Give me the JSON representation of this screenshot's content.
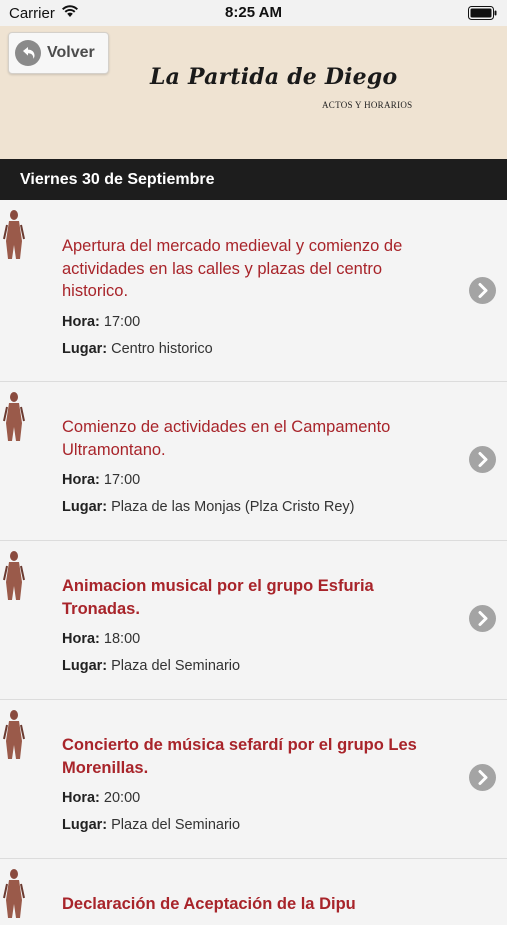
{
  "status": {
    "carrier": "Carrier",
    "time": "8:25 AM"
  },
  "header": {
    "back_label": "Volver",
    "logo_title": "La Partida de Diego",
    "logo_subtitle": "ACTOS Y HORARIOS"
  },
  "day": "Viernes 30 de Septiembre",
  "labels": {
    "hora": "Hora:",
    "lugar": "Lugar:"
  },
  "events": [
    {
      "title": "Apertura del mercado medieval y comienzo de actividades en las calles y plazas del centro historico.",
      "hora": "17:00",
      "lugar": "Centro historico"
    },
    {
      "title": "Comienzo de actividades en el Campamento Ultramontano.",
      "hora": "17:00",
      "lugar": "Plaza de las Monjas (Plza Cristo Rey)"
    },
    {
      "title": "Animacion musical por el grupo Esfuria Tronadas.",
      "hora": "18:00",
      "lugar": "Plaza del Seminario"
    },
    {
      "title": "Concierto de música sefardí por el grupo Les Morenillas.",
      "hora": "20:00",
      "lugar": "Plaza del Seminario"
    },
    {
      "title": "Declaración de Aceptación de la Dipu",
      "hora": "",
      "lugar": ""
    }
  ]
}
